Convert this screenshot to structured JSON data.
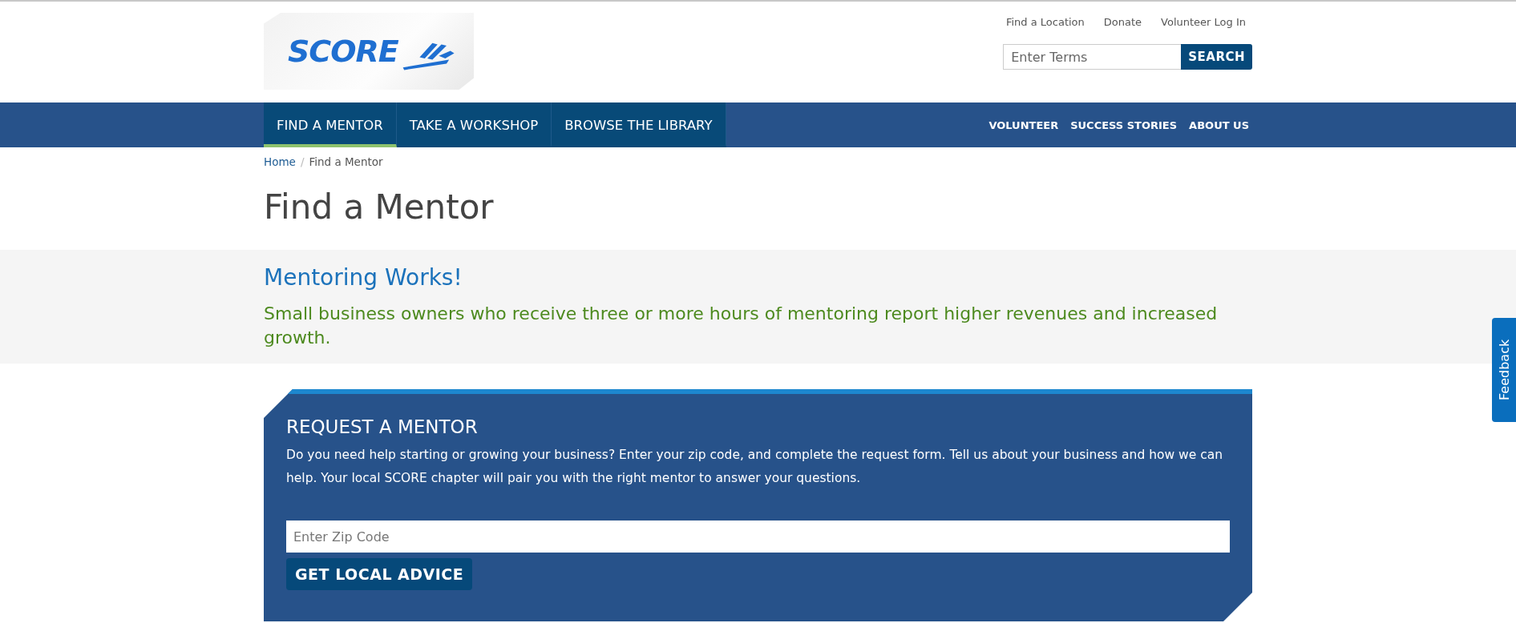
{
  "logo": {
    "text": "SCORE"
  },
  "utility_links": [
    "Find a Location",
    "Donate",
    "Volunteer Log In"
  ],
  "search": {
    "placeholder": "Enter Terms",
    "button": "SEARCH"
  },
  "main_nav": [
    {
      "label": "FIND A MENTOR",
      "selected": true
    },
    {
      "label": "TAKE A WORKSHOP",
      "selected": false
    },
    {
      "label": "BROWSE THE LIBRARY",
      "selected": false
    }
  ],
  "secondary_nav": [
    "VOLUNTEER",
    "SUCCESS STORIES",
    "ABOUT US"
  ],
  "breadcrumb_separator": "/",
  "breadcrumb": [
    {
      "label": "Home",
      "kind": "link"
    },
    {
      "label": "Find a Mentor",
      "kind": "current"
    }
  ],
  "page_title": "Find a Mentor",
  "banner": {
    "heading": "Mentoring Works!",
    "text": "Small business owners who receive three or more hours of mentoring report higher revenues and increased growth."
  },
  "request_panel": {
    "heading": "REQUEST A MENTOR",
    "text": "Do you need help starting or growing your business? Enter your zip code, and complete the request form. Tell us about your business and how we can help. Your local SCORE chapter will pair you with the right mentor to answer your questions.",
    "zip_placeholder": "Enter Zip Code",
    "button": "GET LOCAL ADVICE"
  },
  "feedback_tab": "Feedback"
}
